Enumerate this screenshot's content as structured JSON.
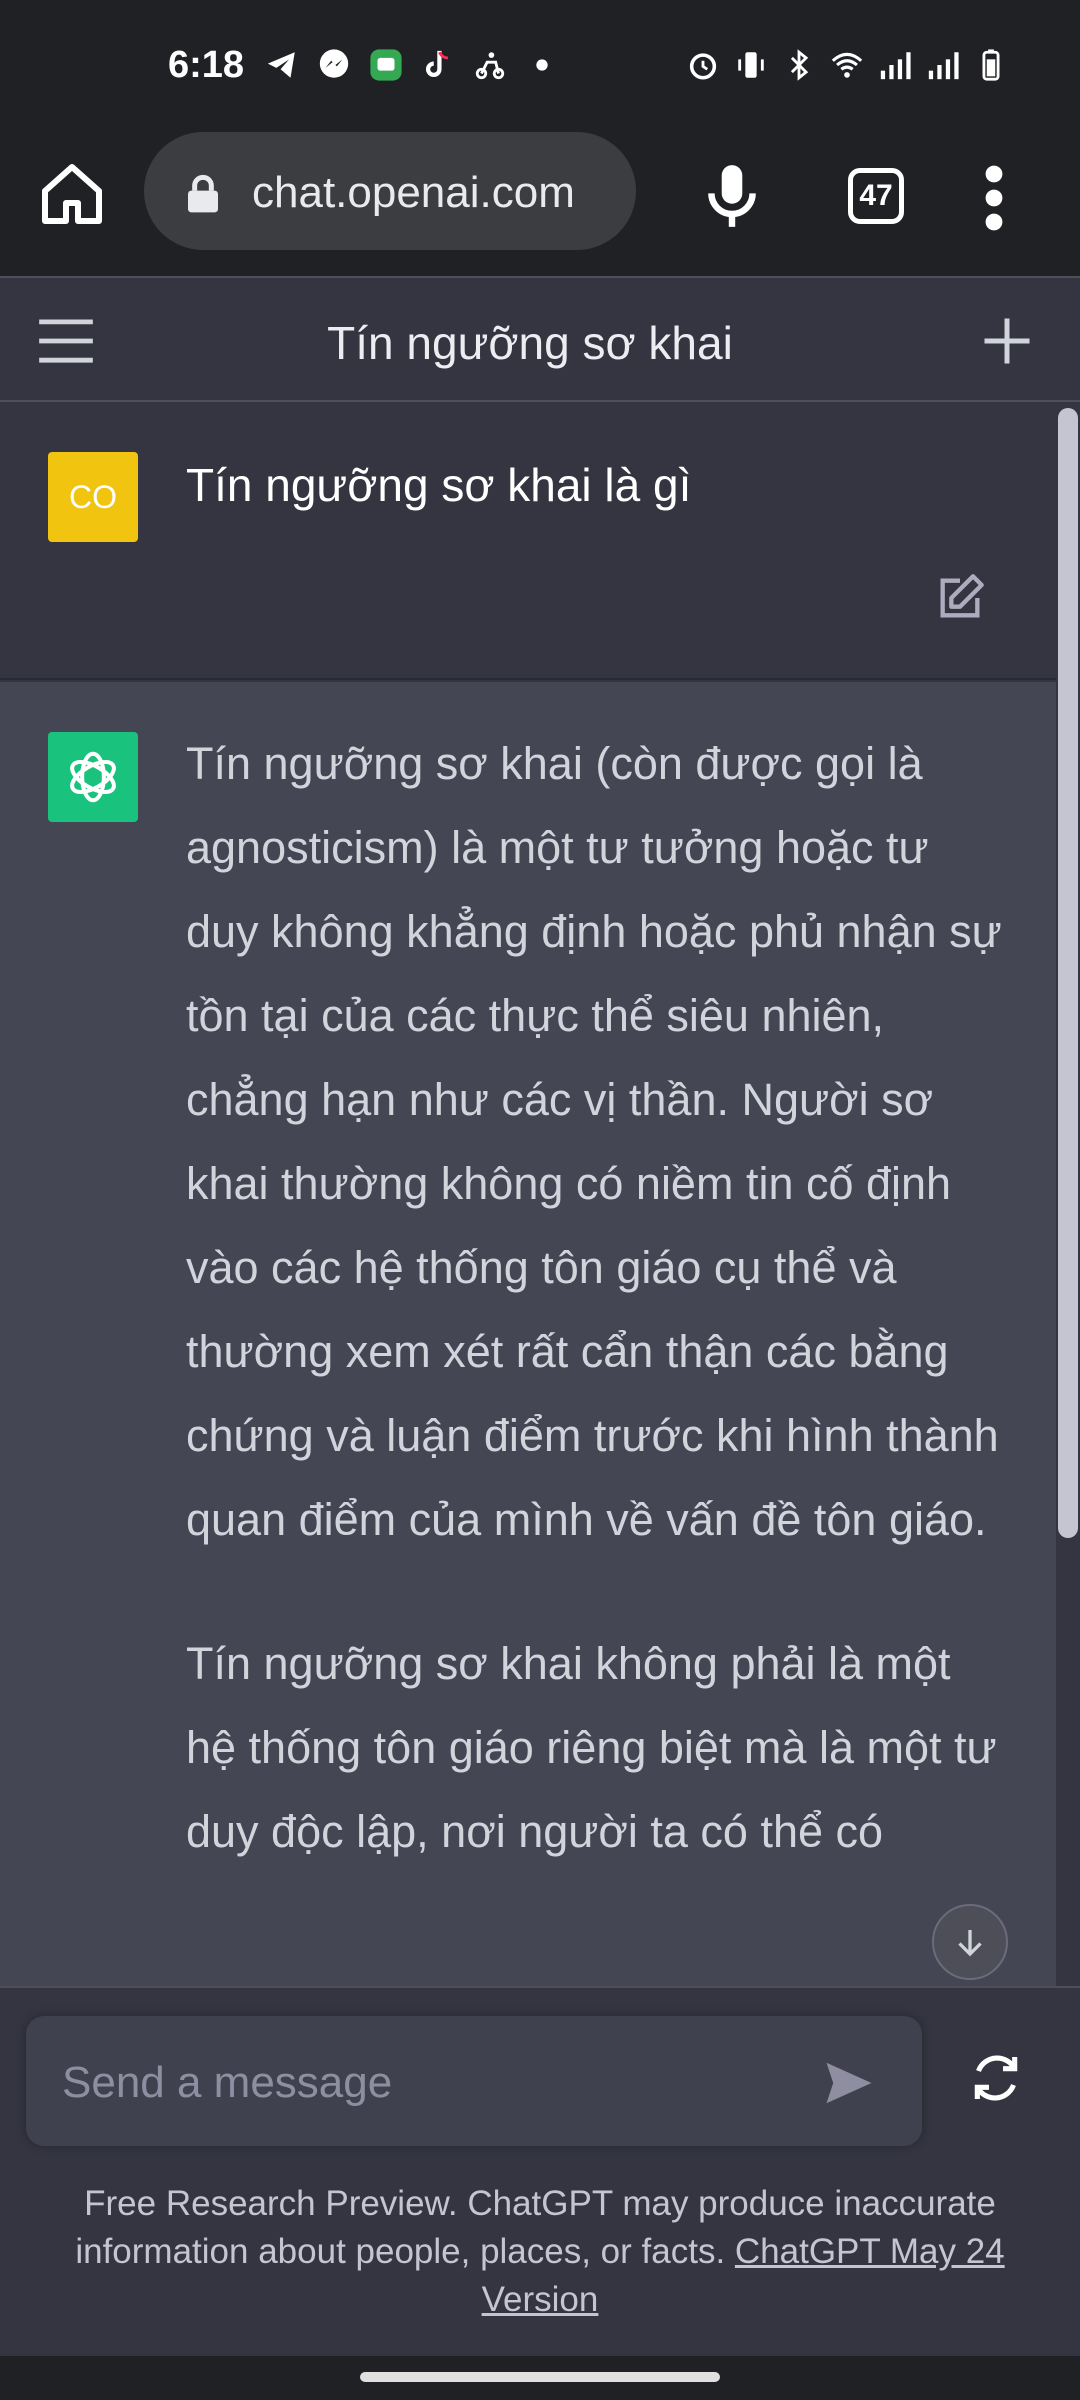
{
  "status_bar": {
    "time": "6:18",
    "left_icons": [
      "telegram-icon",
      "messenger-icon",
      "messages-icon",
      "tiktok-icon",
      "scooter-icon",
      "dot-icon"
    ],
    "right_icons": [
      "alarm-icon",
      "vibrate-icon",
      "bluetooth-icon",
      "wifi-icon",
      "signal-icon",
      "signal-icon-2",
      "battery-icon"
    ]
  },
  "browser": {
    "url": "chat.openai.com",
    "tab_count": "47"
  },
  "header": {
    "title": "Tín ngưỡng sơ khai"
  },
  "conversation": {
    "user": {
      "avatar_initials": "CO",
      "avatar_color": "#f1c40f",
      "message": "Tín ngưỡng sơ khai là gì"
    },
    "assistant": {
      "avatar_color": "#19c37d",
      "paragraphs": [
        "Tín ngưỡng sơ khai (còn được gọi là agnosticism) là một tư tưởng hoặc tư duy không khẳng định hoặc phủ nhận sự tồn tại của các thực thể siêu nhiên, chẳng hạn như các vị thần. Người sơ khai thường không có niềm tin cố định vào các hệ thống tôn giáo cụ thể và thường xem xét rất cẩn thận các bằng chứng và luận điểm trước khi hình thành quan điểm của mình về vấn đề tôn giáo.",
        "Tín ngưỡng sơ khai không phải là một hệ thống tôn giáo riêng biệt mà là một tư duy độc lập, nơi người ta có thể có"
      ]
    }
  },
  "composer": {
    "placeholder": "Send a message",
    "disclaimer_text": "Free Research Preview. ChatGPT may produce inaccurate information about people, places, or facts.",
    "disclaimer_link": "ChatGPT May 24 Version"
  },
  "colors": {
    "background": "#343541",
    "assistant_bg": "#444654",
    "browser_bar": "#202124",
    "accent_green": "#19c37d"
  }
}
